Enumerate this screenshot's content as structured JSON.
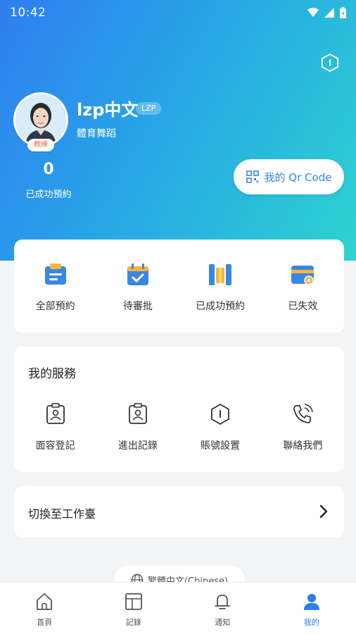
{
  "status_bar": {
    "time": "10:42"
  },
  "colors": {
    "accent": "#2f7df0",
    "gradient_start": "#2f7df0",
    "gradient_end": "#2ed3cf",
    "badge": "#f36b4b"
  },
  "profile": {
    "name": "lzp中文",
    "tag": "LZP",
    "department": "體育舞蹈",
    "role_badge": "教練",
    "success_count": "0",
    "success_label": "已成功預約",
    "qr_button_label": "我的 Qr Code"
  },
  "booking_status": [
    {
      "label": "全部預約",
      "icon": "calendar-list-icon"
    },
    {
      "label": "待審批",
      "icon": "calendar-check-icon"
    },
    {
      "label": "已成功預約",
      "icon": "columns-icon"
    },
    {
      "label": "已失效",
      "icon": "card-invalid-icon"
    }
  ],
  "services": {
    "title": "我的服務",
    "items": [
      {
        "label": "面容登記",
        "icon": "face-id-icon"
      },
      {
        "label": "進出記錄",
        "icon": "access-log-icon"
      },
      {
        "label": "賬號設置",
        "icon": "hexagon-settings-icon"
      },
      {
        "label": "聯絡我們",
        "icon": "phone-icon"
      }
    ]
  },
  "switch_workspace": {
    "label": "切換至工作臺"
  },
  "language": {
    "label": "繁體中文(Chinese)"
  },
  "bottom_nav": [
    {
      "label": "首頁",
      "icon": "home-icon"
    },
    {
      "label": "記錄",
      "icon": "records-icon"
    },
    {
      "label": "通知",
      "icon": "bell-icon"
    },
    {
      "label": "我的",
      "icon": "user-icon"
    }
  ]
}
